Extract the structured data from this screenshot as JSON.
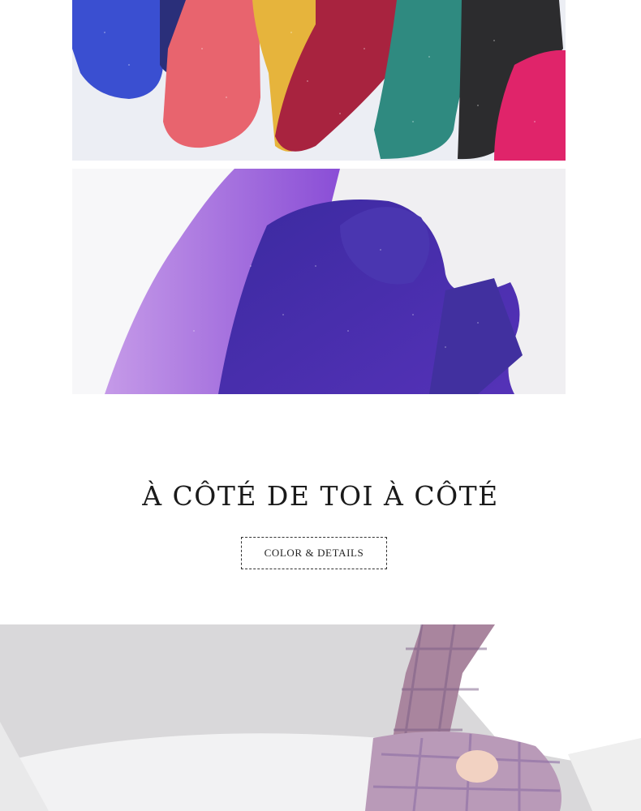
{
  "section": {
    "title": "À CÔTÉ DE TOI À CÔTÉ",
    "details_button": "COLOR & DETAILS"
  },
  "colors": {
    "sock_blue": "#3a4fd1",
    "sock_coral": "#e8646e",
    "sock_mustard": "#e6b43c",
    "sock_burgundy": "#a8233f",
    "sock_teal": "#2f8a80",
    "sock_black": "#2c2c2e",
    "sock_magenta": "#e0246a",
    "sock_violet": "#4a2aa8",
    "sock_lilac": "#a46ae0"
  }
}
